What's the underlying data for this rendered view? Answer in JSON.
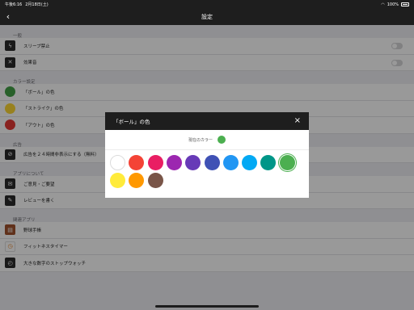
{
  "status_bar": {
    "time": "午後6:16",
    "date": "2月18日(土)",
    "battery": "100%"
  },
  "nav": {
    "title": "設定",
    "back_icon": "chevron-left-icon"
  },
  "sections": [
    {
      "header": "一般",
      "rows": [
        {
          "label": "スリープ禁止",
          "icon": "bolt",
          "toggle": false
        },
        {
          "label": "効果音",
          "icon": "mute",
          "toggle": false
        }
      ]
    },
    {
      "header": "カラー設定",
      "rows": [
        {
          "label": "「ボール」の色",
          "color": "#43a047"
        },
        {
          "label": "「ストライク」の色",
          "color": "#fdd835"
        },
        {
          "label": "「アウト」の色",
          "color": "#e53935"
        }
      ]
    },
    {
      "header": "広告",
      "rows": [
        {
          "label": "広告を２４時間非表示にする（無料）",
          "icon": "ban"
        }
      ]
    },
    {
      "header": "アプリについて",
      "rows": [
        {
          "label": "ご意見・ご要望",
          "icon": "mail"
        },
        {
          "label": "レビューを書く",
          "icon": "edit"
        }
      ]
    },
    {
      "header": "関連アプリ",
      "rows": [
        {
          "label": "野球手帳",
          "icon": "book"
        },
        {
          "label": "フィットネスタイマー",
          "icon": "timer"
        },
        {
          "label": "大きな数字のストップウォッチ",
          "icon": "stopwatch"
        }
      ]
    }
  ],
  "dialog": {
    "title": "「ボール」の色",
    "close": "×",
    "current_label": "現在のカラー",
    "current_color": "#4caf50",
    "colors": [
      "#ffffff",
      "#f44336",
      "#e91e63",
      "#9c27b0",
      "#673ab7",
      "#3f51b5",
      "#2196f3",
      "#03a9f4",
      "#009688",
      "#4caf50",
      "#ffeb3b",
      "#ff9800",
      "#795548"
    ],
    "selected_index": 9
  }
}
